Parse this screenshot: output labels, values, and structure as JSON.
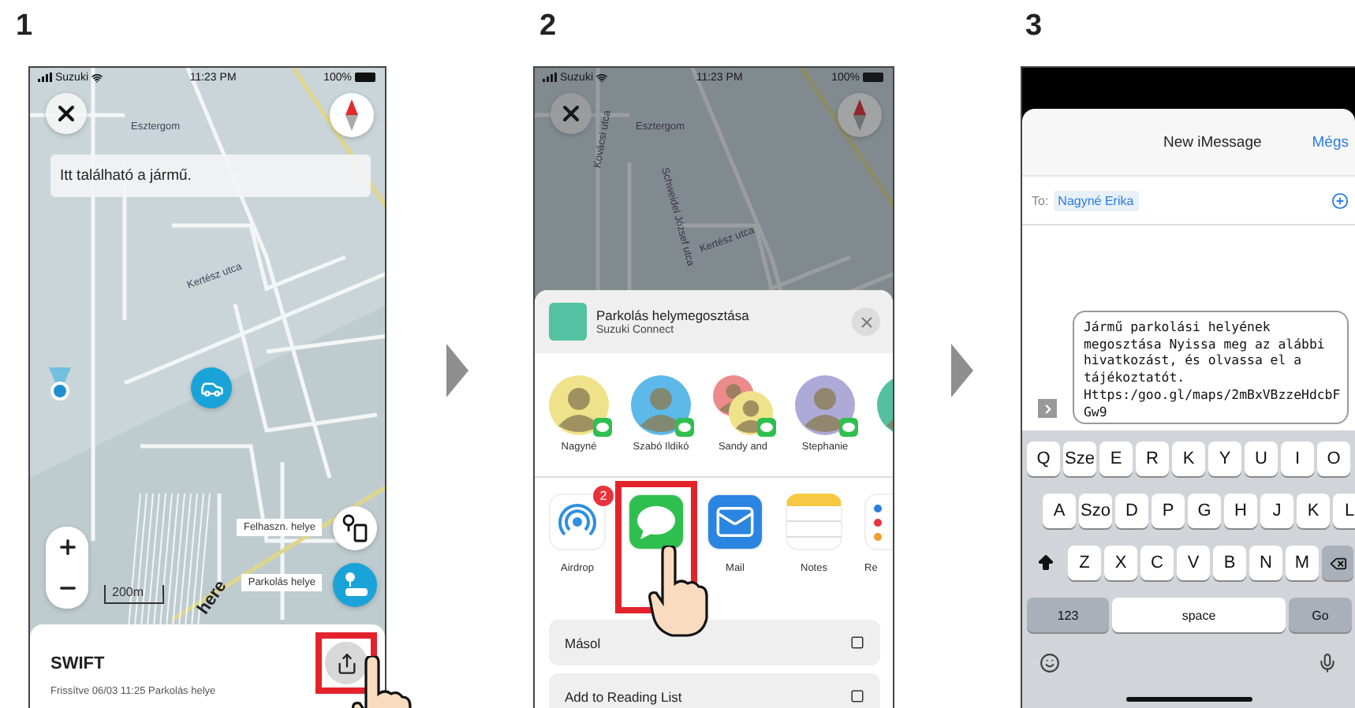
{
  "step_1": {
    "number": "1",
    "status_bar": {
      "carrier": "Suzuki",
      "time": "11:23 PM",
      "battery": "100%"
    },
    "map_labels": [
      "Esztergom",
      "Kertész utca"
    ],
    "banner": "Itt található a jármű.",
    "scale": "200m",
    "map_logo": "here",
    "map_buttons": [
      {
        "label": "Felhaszn. helye",
        "kind": "user"
      },
      {
        "label": "Parkolás helye",
        "kind": "parking"
      }
    ],
    "vehicle": {
      "name": "SWIFT",
      "updated": "Frissítve 06/03 11:25 Parkolás helye"
    },
    "share_button": {
      "highlighted": true
    }
  },
  "step_2": {
    "number": "2",
    "status_bar": {
      "carrier": "Suzuki",
      "time": "11:23 PM",
      "battery": "100%"
    },
    "map_labels": [
      "Esztergom",
      "Kovácsi utca",
      "Schweidel József utca",
      "Kertész utca"
    ],
    "share_sheet": {
      "title": "Parkolás helymegosztása",
      "subtitle": "Suzuki Connect",
      "contacts": [
        {
          "name": "Nagyné",
          "kind": "person",
          "color": "#f0e28a"
        },
        {
          "name": "Szabó Ildikó",
          "kind": "person",
          "color": "#5db9e9"
        },
        {
          "name": "Sandy and",
          "kind": "group",
          "color": "#f0e28a"
        },
        {
          "name": "Stephanie",
          "kind": "person",
          "color": "#aeaad8"
        },
        {
          "kind": "person",
          "color": "#55c0a0"
        }
      ],
      "apps": [
        {
          "kind": "airdrop",
          "label": "Airdrop",
          "badge": "2",
          "highlighted": false
        },
        {
          "kind": "messages",
          "highlighted": true
        },
        {
          "kind": "mail",
          "label": "Mail",
          "highlighted": false
        },
        {
          "kind": "notes",
          "label": "Notes",
          "highlighted": false
        },
        {
          "kind": "reminders",
          "label": "Re",
          "highlighted": false
        }
      ],
      "actions": [
        "Másol",
        "Add to Reading List"
      ]
    }
  },
  "step_3": {
    "number": "3",
    "title": "New iMessage",
    "cancel": "Mégs",
    "to_label": "To:",
    "recipient": "Nagyné Erika",
    "message": {
      "body": "Jármű parkolási helyének megosztása Nyissa meg az alábbi hivatkozást, és olvassa el a tájékoztatót.",
      "link": "Https:/goo.gl/maps/2mBxVBzzeHdcbFGw9"
    },
    "keyboard": {
      "top_row": [
        "Q",
        "Sze",
        "E",
        "R",
        "K",
        "Y",
        "U",
        "I",
        "O"
      ],
      "middle_row": [
        "A",
        "Szo",
        "D",
        "P",
        "G",
        "H",
        "J",
        "K",
        "L"
      ],
      "bottom_row": [
        "Z",
        "X",
        "C",
        "V",
        "B",
        "N",
        "M"
      ],
      "numbers_key": "123",
      "space_key": "space",
      "return_key": "Go"
    }
  }
}
